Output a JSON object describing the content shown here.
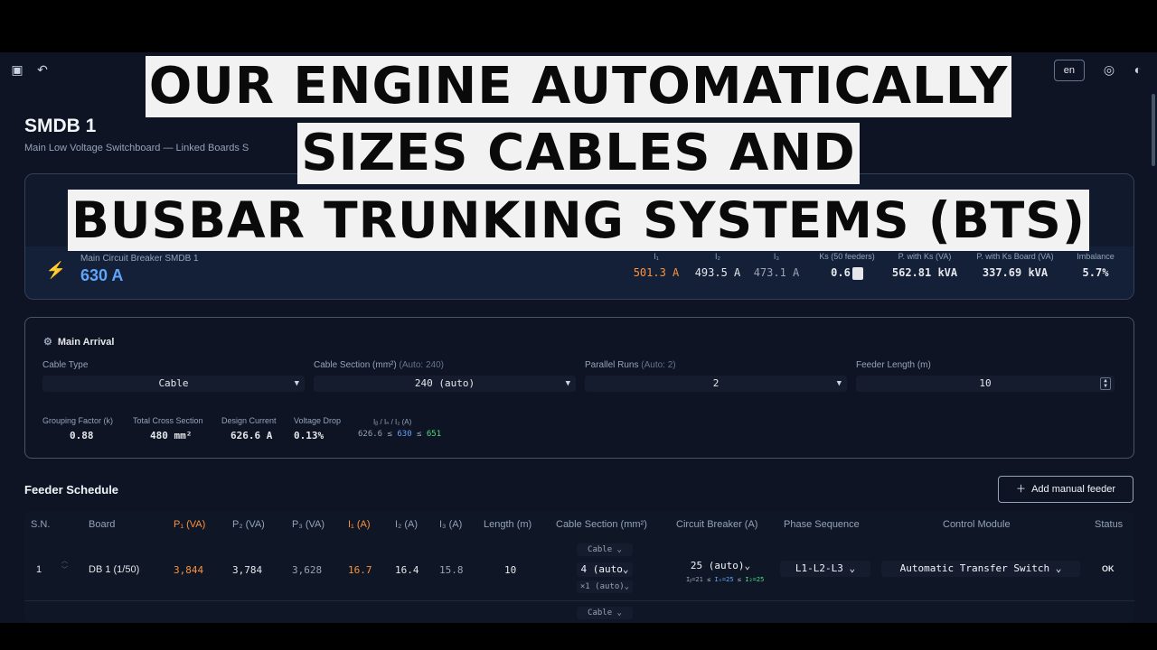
{
  "overlay": {
    "line1": "OUR ENGINE AUTOMATICALLY",
    "line2": "SIZES CABLES AND",
    "line3": "BUSBAR TRUNKING SYSTEMS (BTS)"
  },
  "topbar": {
    "button_label": "en",
    "icons": [
      "sidebar-icon",
      "undo-icon",
      "globe-icon",
      "theme-icon"
    ]
  },
  "page": {
    "title": "SMDB 1",
    "subtitle": "Main Low Voltage Switchboard — Linked Boards S"
  },
  "summary": {
    "mcb_label": "Main Circuit Breaker SMDB 1",
    "mcb_value": "630 A",
    "stats": [
      {
        "label": "I₁",
        "value": "501.3 A"
      },
      {
        "label": "I₂",
        "value": "493.5 A"
      },
      {
        "label": "I₃",
        "value": "473.1 A"
      },
      {
        "label": "Ks (50 feeders)",
        "value": "0.6"
      },
      {
        "label": "P. with Ks (VA)",
        "value": "562.81 kVA"
      },
      {
        "label": "P. with Ks Board (VA)",
        "value": "337.69 kVA"
      },
      {
        "label": "Imbalance",
        "value": "5.7%"
      }
    ]
  },
  "arrival": {
    "title": "Main Arrival",
    "cable_type": {
      "label": "Cable Type",
      "value": "Cable"
    },
    "cable_section": {
      "label": "Cable Section (mm²)",
      "aux": "(Auto: 240)",
      "value": "240 (auto)"
    },
    "parallel_runs": {
      "label": "Parallel Runs",
      "aux": "(Auto: 2)",
      "value": "2"
    },
    "feeder_length": {
      "label": "Feeder Length (m)",
      "value": "10"
    },
    "grouping": {
      "label": "Grouping Factor (k)",
      "value": "0.88"
    },
    "cross_section": {
      "label": "Total Cross Section",
      "value": "480 mm²"
    },
    "design_current": {
      "label": "Design Current",
      "value": "626.6 A"
    },
    "voltage_drop": {
      "label": "Voltage Drop",
      "value": "0.13%"
    },
    "range_label": "Iᵦ / Iₙ / I₂ (A)",
    "range": {
      "ib": "626.6",
      "in": "630",
      "i2": "651",
      "sep": "≤"
    }
  },
  "feeder": {
    "title": "Feeder Schedule",
    "add_label": "Add manual feeder",
    "headers": [
      "S.N.",
      "Board",
      "P₁ (VA)",
      "P₂ (VA)",
      "P₃ (VA)",
      "I₁ (A)",
      "I₂ (A)",
      "I₃ (A)",
      "Length (m)",
      "Cable Section (mm²)",
      "Circuit Breaker (A)",
      "Phase Sequence",
      "Control Module",
      "Status"
    ],
    "row": {
      "sn": "1",
      "board": "DB 1 (1/50)",
      "p1": "3,844",
      "p2": "3,784",
      "p3": "3,628",
      "i1": "16.7",
      "i2": "16.4",
      "i3": "15.8",
      "length": "10",
      "cable_kind": "Cable",
      "section": "4 (auto",
      "runs": "×1 (auto)",
      "breaker": "25 (auto)",
      "breaker_detail": {
        "ib": "Iᵦ=21",
        "in": "Iₙ=25",
        "i2": "I₂=25",
        "sep": "≤"
      },
      "phase": "L1-L2-L3",
      "control": "Automatic Transfer Switch",
      "status": "OK"
    },
    "next_row_cable_kind": "Cable"
  },
  "colors": {
    "background": "#0e1424",
    "accent_blue": "#60a5fa",
    "accent_orange": "#fb923c",
    "accent_green": "#4ade80"
  }
}
